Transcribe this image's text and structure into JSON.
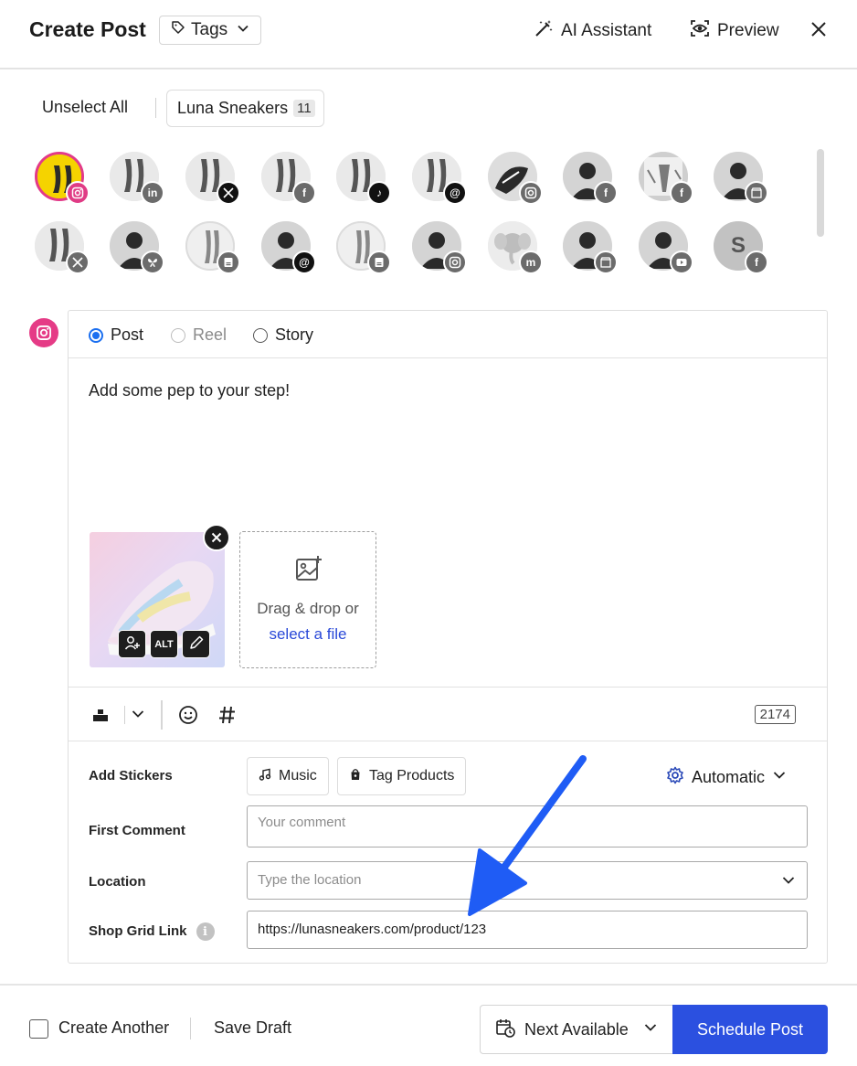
{
  "header": {
    "title": "Create Post",
    "tags_label": "Tags",
    "ai_label": "AI Assistant",
    "preview_label": "Preview"
  },
  "accounts_bar": {
    "unselect_label": "Unselect All",
    "group_name": "Luna Sneakers",
    "group_count": "11"
  },
  "avatars": [
    {
      "network": "instagram-icon",
      "selected": true
    },
    {
      "network": "linkedin-icon"
    },
    {
      "network": "x-icon"
    },
    {
      "network": "facebook-icon"
    },
    {
      "network": "tiktok-icon"
    },
    {
      "network": "threads-icon"
    },
    {
      "network": "instagram-icon"
    },
    {
      "network": "facebook-icon"
    },
    {
      "network": "facebook-icon"
    },
    {
      "network": "google-business-icon"
    },
    {
      "network": "x-icon"
    },
    {
      "network": "bluesky-icon"
    },
    {
      "network": "business-card-icon"
    },
    {
      "network": "threads-icon"
    },
    {
      "network": "business-card-icon"
    },
    {
      "network": "instagram-icon"
    },
    {
      "network": "mastodon-icon"
    },
    {
      "network": "google-business-icon"
    },
    {
      "network": "youtube-icon"
    },
    {
      "network": "facebook-icon",
      "letter": "S"
    }
  ],
  "composer": {
    "types": {
      "post": "Post",
      "reel": "Reel",
      "story": "Story"
    },
    "caption": "Add some pep to your step!",
    "alt_label": "ALT",
    "dropzone_text": "Drag & drop or",
    "dropzone_link": "select a file",
    "char_count": "2174",
    "stickers_label": "Add Stickers",
    "music_label": "Music",
    "tag_products_label": "Tag Products",
    "automatic_label": "Automatic",
    "first_comment_label": "First Comment",
    "first_comment_placeholder": "Your comment",
    "location_label": "Location",
    "location_placeholder": "Type the location",
    "shop_grid_label": "Shop Grid Link",
    "shop_grid_value": "https://lunasneakers.com/product/123"
  },
  "footer": {
    "create_another": "Create Another",
    "save_draft": "Save Draft",
    "next_available": "Next Available",
    "schedule": "Schedule Post"
  },
  "colors": {
    "primary": "#2b50e0",
    "instagram": "#e53b86",
    "annotation_arrow": "#1f5cf5"
  }
}
